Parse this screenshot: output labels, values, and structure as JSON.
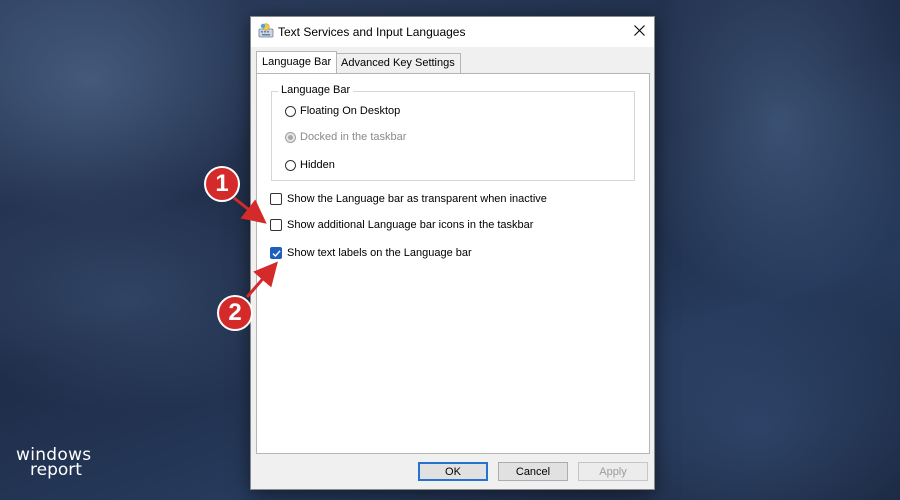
{
  "window": {
    "title": "Text Services and Input Languages",
    "close_icon": "close-icon",
    "app_icon": "keyboard-globe-icon"
  },
  "tabs": [
    {
      "label": "Language Bar",
      "active": true
    },
    {
      "label": "Advanced Key Settings",
      "active": false
    }
  ],
  "language_bar_group": {
    "legend": "Language Bar",
    "options": [
      {
        "label": "Floating On Desktop",
        "selected": false,
        "disabled": false
      },
      {
        "label": "Docked in the taskbar",
        "selected": true,
        "disabled": true
      },
      {
        "label": "Hidden",
        "selected": false,
        "disabled": false
      }
    ]
  },
  "checkboxes": [
    {
      "label": "Show the Language bar as transparent when inactive",
      "checked": false
    },
    {
      "label": "Show additional Language bar icons in the taskbar",
      "checked": false
    },
    {
      "label": "Show text labels on the Language bar",
      "checked": true
    }
  ],
  "buttons": {
    "ok": "OK",
    "cancel": "Cancel",
    "apply": "Apply"
  },
  "annotations": {
    "marker_1": "1",
    "marker_2": "2",
    "color": "#d42a2a"
  },
  "watermark": {
    "line1": "windows",
    "line2": "report"
  }
}
